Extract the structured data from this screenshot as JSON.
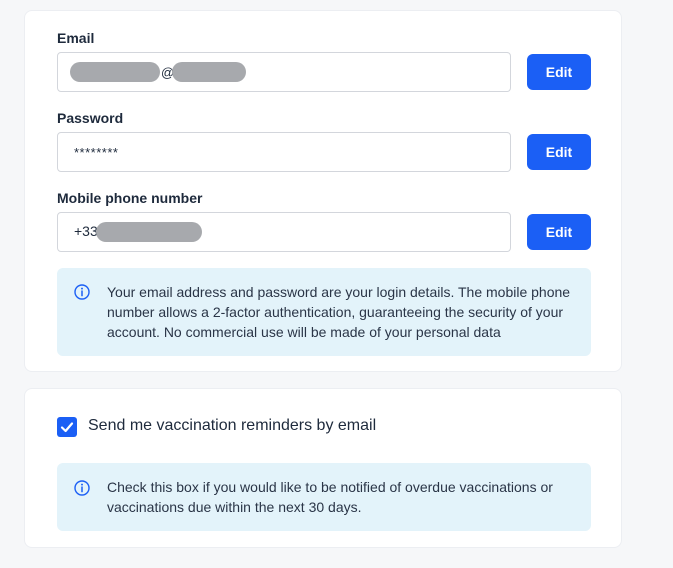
{
  "account": {
    "email": {
      "label": "Email",
      "at_sign": "@",
      "edit_label": "Edit"
    },
    "password": {
      "label": "Password",
      "value": "********",
      "edit_label": "Edit"
    },
    "phone": {
      "label": "Mobile phone number",
      "prefix": "+33",
      "edit_label": "Edit"
    },
    "info": "Your email address and password are your login details. The mobile phone number allows a 2-factor authentication, guaranteeing the security of your account. No commercial use will be made of your personal data"
  },
  "reminders": {
    "checkbox_label": "Send me vaccination reminders by email",
    "checked": true,
    "info": "Check this box if you would like to be notified of overdue vaccinations or vaccinations due within the next 30 days."
  },
  "colors": {
    "accent": "#1b5ff5",
    "info_background": "#e3f3fa",
    "redaction": "#a7a9ad"
  },
  "icons": {
    "info": "info-circle-icon",
    "check": "checkmark-icon"
  }
}
